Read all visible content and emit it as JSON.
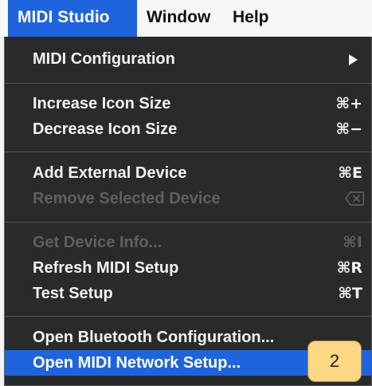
{
  "menubar": {
    "items": [
      {
        "label": "MIDI Studio"
      },
      {
        "label": "Window"
      },
      {
        "label": "Help"
      }
    ]
  },
  "menu": {
    "midi_configuration": {
      "label": "MIDI Configuration"
    },
    "increase_icon_size": {
      "label": "Increase Icon Size",
      "shortcut": "⌘+"
    },
    "decrease_icon_size": {
      "label": "Decrease Icon Size",
      "shortcut": "⌘−"
    },
    "add_external_device": {
      "label": "Add External Device",
      "shortcut": "⌘E"
    },
    "remove_selected_device": {
      "label": "Remove Selected Device"
    },
    "get_device_info": {
      "label": "Get Device Info...",
      "shortcut": "⌘I"
    },
    "refresh_midi_setup": {
      "label": "Refresh MIDI Setup",
      "shortcut": "⌘R"
    },
    "test_setup": {
      "label": "Test Setup",
      "shortcut": "⌘T"
    },
    "open_bluetooth_configuration": {
      "label": "Open Bluetooth Configuration..."
    },
    "open_midi_network_setup": {
      "label": "Open MIDI Network Setup..."
    }
  },
  "annotation": {
    "label": "2"
  },
  "colors": {
    "highlight": "#1f64dd",
    "menu_background": "#2a2a2b",
    "disabled_text": "#5f5f61",
    "annotation_fill": "#fcd784"
  }
}
